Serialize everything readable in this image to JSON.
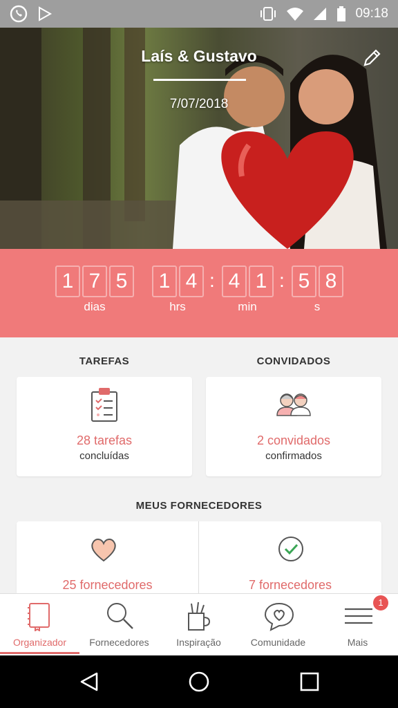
{
  "status_bar": {
    "time": "09:18"
  },
  "hero": {
    "couple_names": "Laís & Gustavo",
    "date": "7/07/2018"
  },
  "countdown": {
    "days": [
      "1",
      "7",
      "5"
    ],
    "hours": [
      "1",
      "4"
    ],
    "minutes": [
      "4",
      "1"
    ],
    "seconds": [
      "5",
      "8"
    ],
    "labels": {
      "days": "dias",
      "hours": "hrs",
      "minutes": "min",
      "seconds": "s"
    }
  },
  "tasks": {
    "section_title": "TAREFAS",
    "count_text": "28 tarefas",
    "sub_text": "concluídas"
  },
  "guests": {
    "section_title": "CONVIDADOS",
    "count_text": "2 convidados",
    "sub_text": "confirmados"
  },
  "suppliers": {
    "section_title": "MEUS FORNECEDORES",
    "favorites_text": "25 fornecedores",
    "hired_text": "7 fornecedores"
  },
  "bottom_nav": {
    "items": [
      {
        "label": "Organizador"
      },
      {
        "label": "Fornecedores"
      },
      {
        "label": "Inspiração"
      },
      {
        "label": "Comunidade"
      },
      {
        "label": "Mais"
      }
    ],
    "badge_count": "1"
  },
  "colors": {
    "accent": "#f07a7a",
    "accent_text": "#e06a6a"
  }
}
